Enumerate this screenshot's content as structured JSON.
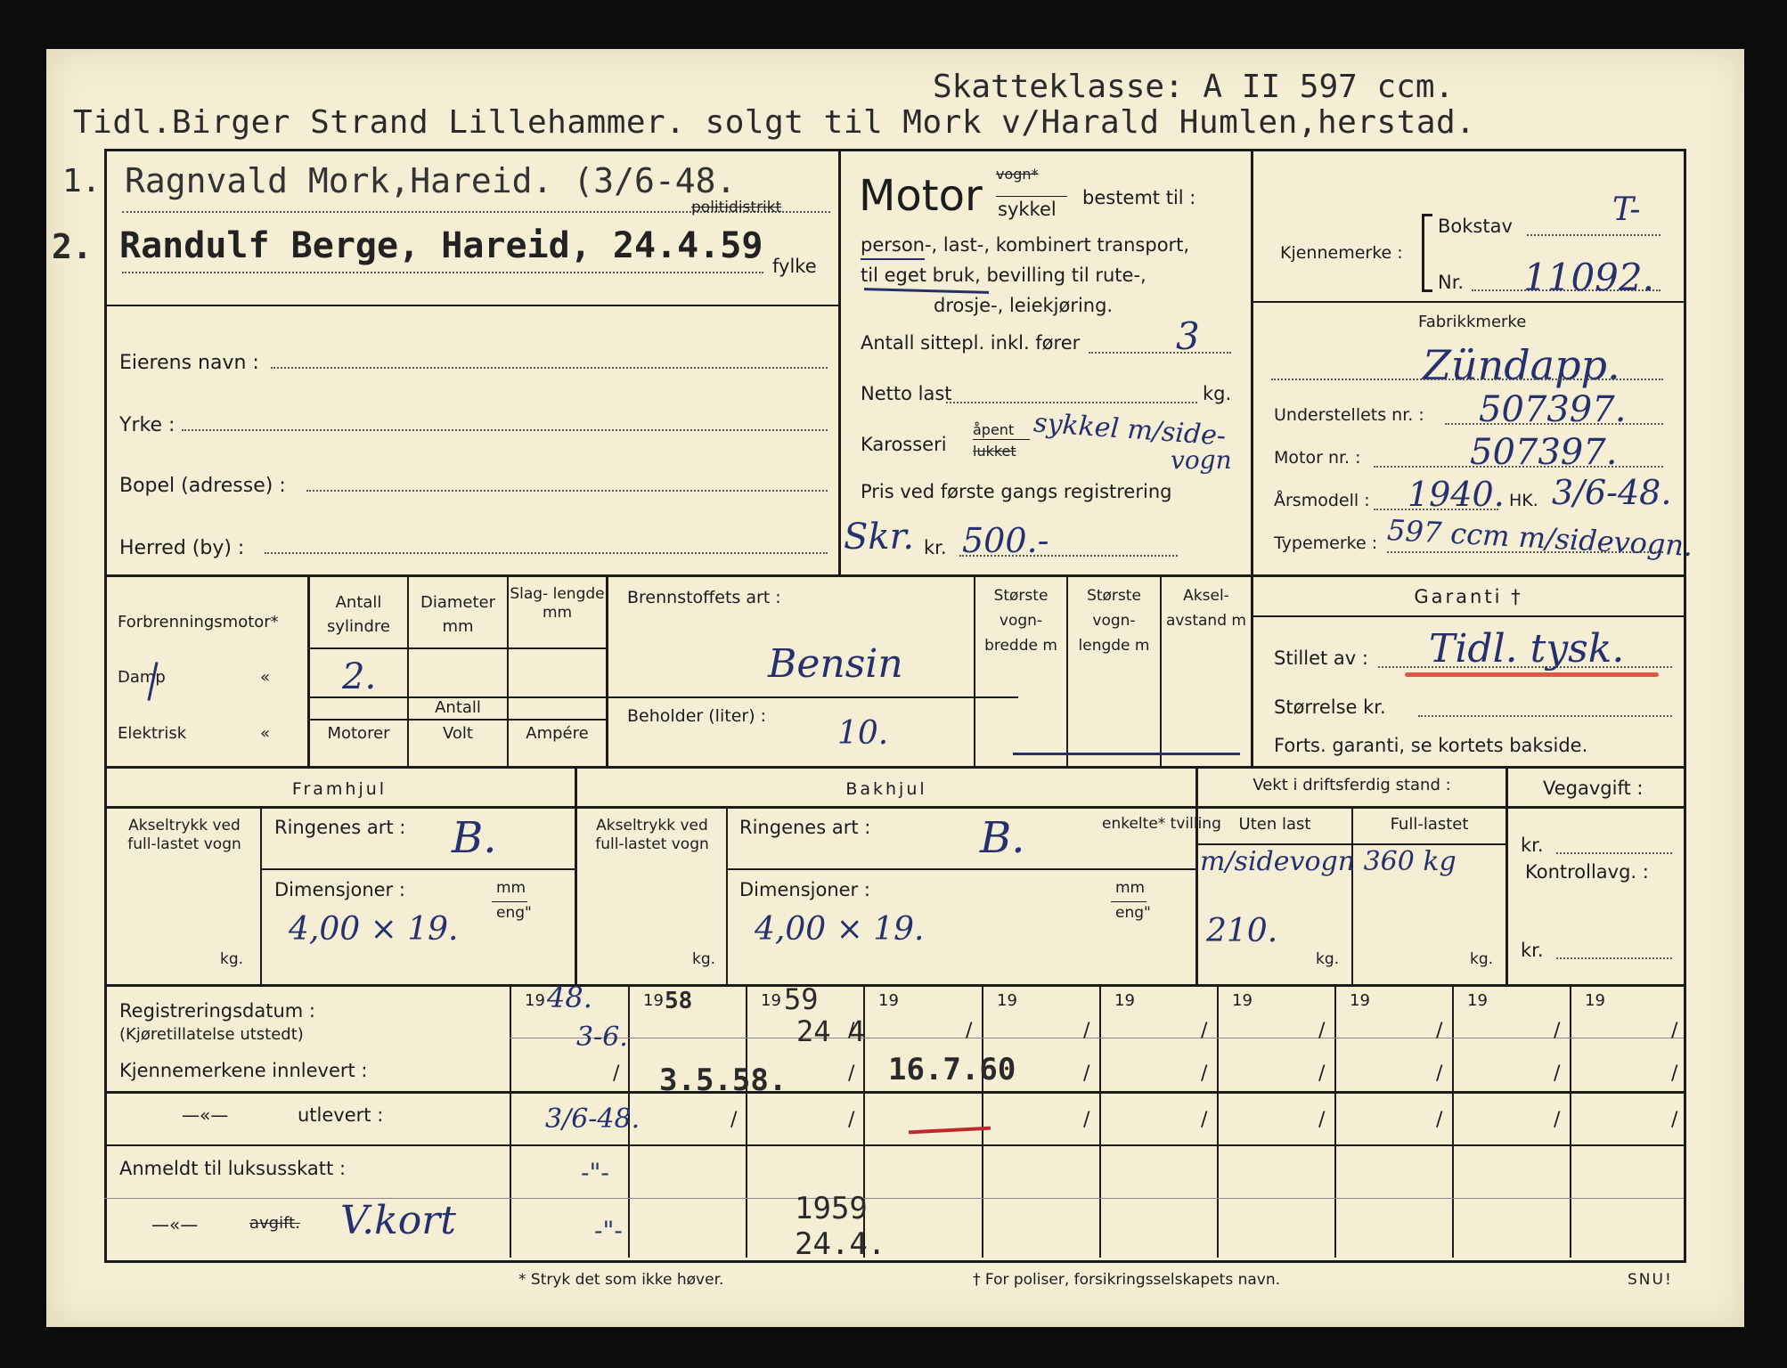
{
  "header": {
    "tax_class": "Skatteklasse: A II 597 ccm.",
    "history_note": "Tidl.Birger Strand Lillehammer. solgt til Mork v/Harald Humlen,herstad."
  },
  "owners": {
    "row1_num": "1.",
    "row1_text": "Ragnvald Mork,Hareid. (3/6-48.",
    "row2_num": "2.",
    "row2_text": "Randulf Berge, Hareid, 24.4.59",
    "politidistrikt_label": "politidistrikt",
    "fylke_label": "fylke"
  },
  "owner_fields": {
    "name_label": "Eierens navn :",
    "occupation_label": "Yrke :",
    "address_label": "Bopel (adresse) :",
    "district_label": "Herred (by) :"
  },
  "motor": {
    "title": "Motor",
    "vogn_struck": "vogn*",
    "sykkel": "sykkel",
    "bestemt": "bestemt til :",
    "purpose_line1": "person-, last-, kombinert transport,",
    "purpose_line2": "til eget bruk, bevilling til rute-,",
    "purpose_line3": "drosje-, leiekjøring.",
    "seats_label": "Antall sittepl. inkl. fører",
    "seats_value": "3",
    "net_load_label": "Netto last",
    "kg": "kg.",
    "body_label": "Karosseri",
    "body_open": "åpent",
    "body_closed": "lukket",
    "body_value": "sykkel m/side-",
    "body_value2": "vogn",
    "price_label": "Pris ved første gangs registrering",
    "price_prefix_value": "Skr.",
    "kr": "kr.",
    "price_value": "500.-"
  },
  "registration": {
    "plate_label": "Kjennemerke :",
    "letter_label": "Bokstav",
    "letter_value": "T-",
    "number_label": "Nr.",
    "number_value": "11092.",
    "make_label": "Fabrikkmerke",
    "make_value": "Zündapp.",
    "chassis_label": "Understellets nr. :",
    "chassis_value": "507397.",
    "engine_label": "Motor nr. :",
    "engine_value": "507397.",
    "model_year_label": "Årsmodell :",
    "model_year_value": "1940.",
    "hk_label": "HK.",
    "hk_value": "3/6-48.",
    "type_label": "Typemerke :",
    "type_value": "597 ccm m/sidevogn."
  },
  "engine_table": {
    "combustion_label": "Forbrenningsmotor*",
    "steam_label": "Damp",
    "electric_label": "Elektrisk",
    "ditto": "«",
    "cyl_header": "Antall sylindre",
    "diam_header": "Diameter mm",
    "stroke_header": "Slag- lengde mm",
    "cyl_value": "2.",
    "antall_label": "Antall",
    "motors_header": "Motorer",
    "volt_header": "Volt",
    "ampere_header": "Ampére",
    "fuel_label": "Brennstoffets art :",
    "fuel_value": "Bensin",
    "tank_label": "Beholder (liter) :",
    "tank_value": "10.",
    "max_width_header": "Største vogn- bredde m",
    "max_length_header": "Største vogn- lengde m",
    "axle_header": "Aksel- avstand m",
    "guarantee_title": "Garanti †",
    "issued_by_label": "Stillet av :",
    "issued_by_value": "Tidl. tysk.",
    "size_label": "Størrelse kr.",
    "cont_label": "Forts. garanti, se kortets bakside."
  },
  "wheels": {
    "front_title": "Framhjul",
    "rear_title": "Bakhjul",
    "axle_load": "Akseltrykk ved full-lastet vogn",
    "kg": "kg.",
    "ring_label": "Ringenes art :",
    "front_ring_value": "B.",
    "rear_ring_value": "B.",
    "dim_label": "Dimensjoner :",
    "mm": "mm",
    "eng": "eng\"",
    "front_dim": "4,00 × 19.",
    "rear_dim": "4,00 ×   19.",
    "single_twin": "enkelte* tvilling",
    "weight_title": "Vekt i driftsferdig stand :",
    "unloaded_header": "Uten last",
    "loaded_header": "Full-lastet",
    "weight_value": "m/sidevogn 360 kg",
    "unloaded_value": "210.",
    "road_tax_label": "Vegavgift :",
    "kr": "kr.",
    "control_label": "Kontrollavg. :"
  },
  "history": {
    "reg_date_label": "Registreringsdatum :",
    "reg_date_sub": "(Kjøretillatelse utstedt)",
    "plates_in_label": "Kjennemerkene innlevert :",
    "plates_out_ditto": "—«—",
    "plates_out_label": "utlevert :",
    "luxury_label": "Anmeldt til luksusskatt :",
    "luxury_ditto": "—«—",
    "luxury_fee_label": "avgift.",
    "luxury_fee_value": "V.kort",
    "year_prefix": "19",
    "col1_year": "48.",
    "col1_date": "3-6.",
    "col1_out": "3/6-48.",
    "col1_lux1": "-\"-",
    "col1_lux2": "-\"-",
    "col2_year": "58",
    "col2_in": "3.5.58.",
    "col3_year": "59",
    "col3_date": "24 4",
    "col4_in": "16.7.60",
    "col3_lux1": "1959",
    "col3_lux2": "24.4.",
    "slash": "/"
  },
  "footer": {
    "note1": "* Stryk det som ikke høver.",
    "note2": "† For poliser, forsikringsselskapets navn.",
    "snu": "SNU!"
  }
}
